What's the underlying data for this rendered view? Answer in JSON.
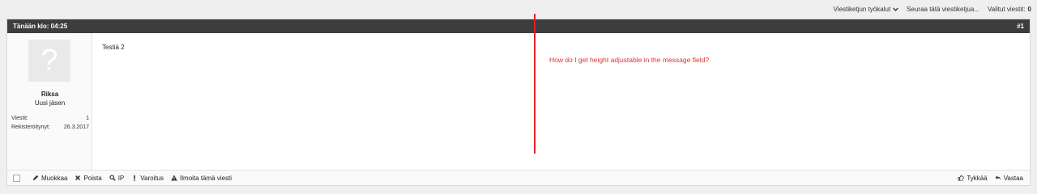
{
  "top_toolbar": {
    "thread_tools_label": "Viestiketjun työkalut",
    "follow_label": "Seuraa tätä viestiketjua...",
    "selected_label": "Valitut viestit:",
    "selected_count": "0"
  },
  "post": {
    "timestamp": "Tänään klo: 04:25",
    "number": "#1",
    "user": {
      "avatar_placeholder": "?",
      "name": "Riksa",
      "title": "Uusi jäsen",
      "posts_label": "Viestit:",
      "posts_value": "1",
      "registered_label": "Rekisteröitynyt:",
      "registered_value": "26.3.2017"
    },
    "message": "Testiä 2",
    "footer": {
      "edit": "Muokkaa",
      "delete": "Poista",
      "ip": "IP",
      "warning": "Varoitus",
      "report": "Ilmoita tämä viesti",
      "like": "Tykkää",
      "reply": "Vastaa"
    }
  },
  "annotation": {
    "text": "How do I get height adjustable in the message field?",
    "color": "#e0302b"
  },
  "colors": {
    "header_bg": "#3d3d3d",
    "page_bg": "#efefef"
  }
}
